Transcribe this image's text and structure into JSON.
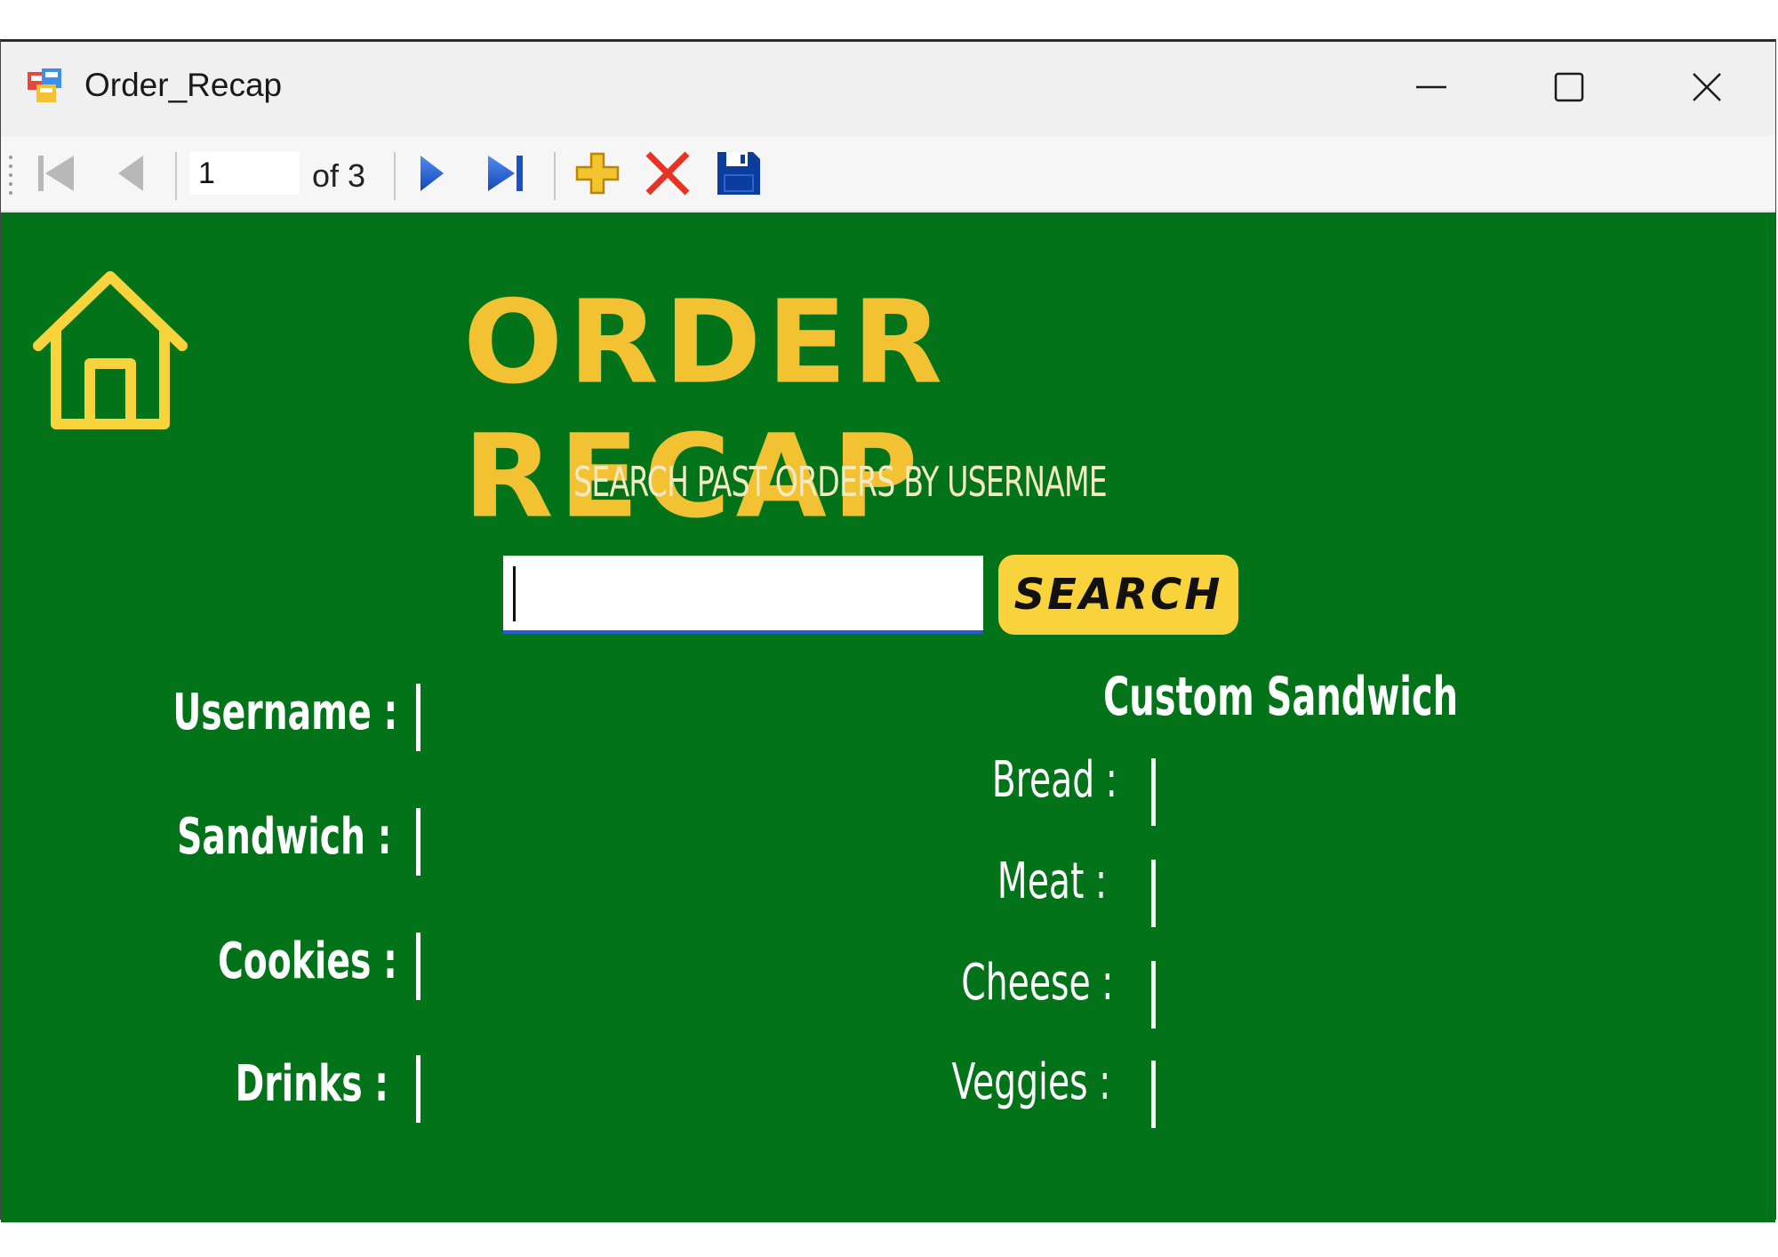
{
  "window": {
    "title": "Order_Recap"
  },
  "navigator": {
    "position": "1",
    "count_label": "of 3"
  },
  "main": {
    "title": "ORDER RECAP",
    "subtitle": "SEARCH PAST ORDERS BY USERNAME",
    "search": {
      "value": "",
      "placeholder": "",
      "button_label": "SEARCH"
    }
  },
  "order_fields": [
    {
      "label": "Username",
      "separator": ":",
      "value": ""
    },
    {
      "label": "Sandwich",
      "separator": ":",
      "value": ""
    },
    {
      "label": "Cookies",
      "separator": ":",
      "value": ""
    },
    {
      "label": "Drinks",
      "separator": ":",
      "value": ""
    }
  ],
  "custom_sandwich": {
    "heading": "Custom Sandwich",
    "fields": [
      {
        "label": "Bread",
        "separator": ":",
        "value": ""
      },
      {
        "label": "Meat",
        "separator": ":",
        "value": ""
      },
      {
        "label": "Cheese",
        "separator": ":",
        "value": ""
      },
      {
        "label": "Veggies",
        "separator": ":",
        "value": ""
      }
    ]
  },
  "colors": {
    "background": "#03731a",
    "title": "#f2c233",
    "button": "#f8d33c",
    "icon_yellow": "#f7d33c"
  },
  "icons": {
    "app": "app-form-icon",
    "minimize": "minimize-icon",
    "maximize": "maximize-icon",
    "close": "close-icon",
    "first": "move-first-icon",
    "previous": "move-previous-icon",
    "next": "move-next-icon",
    "last": "move-last-icon",
    "add": "add-new-icon",
    "delete": "delete-icon",
    "save": "save-icon",
    "home": "home-icon"
  }
}
